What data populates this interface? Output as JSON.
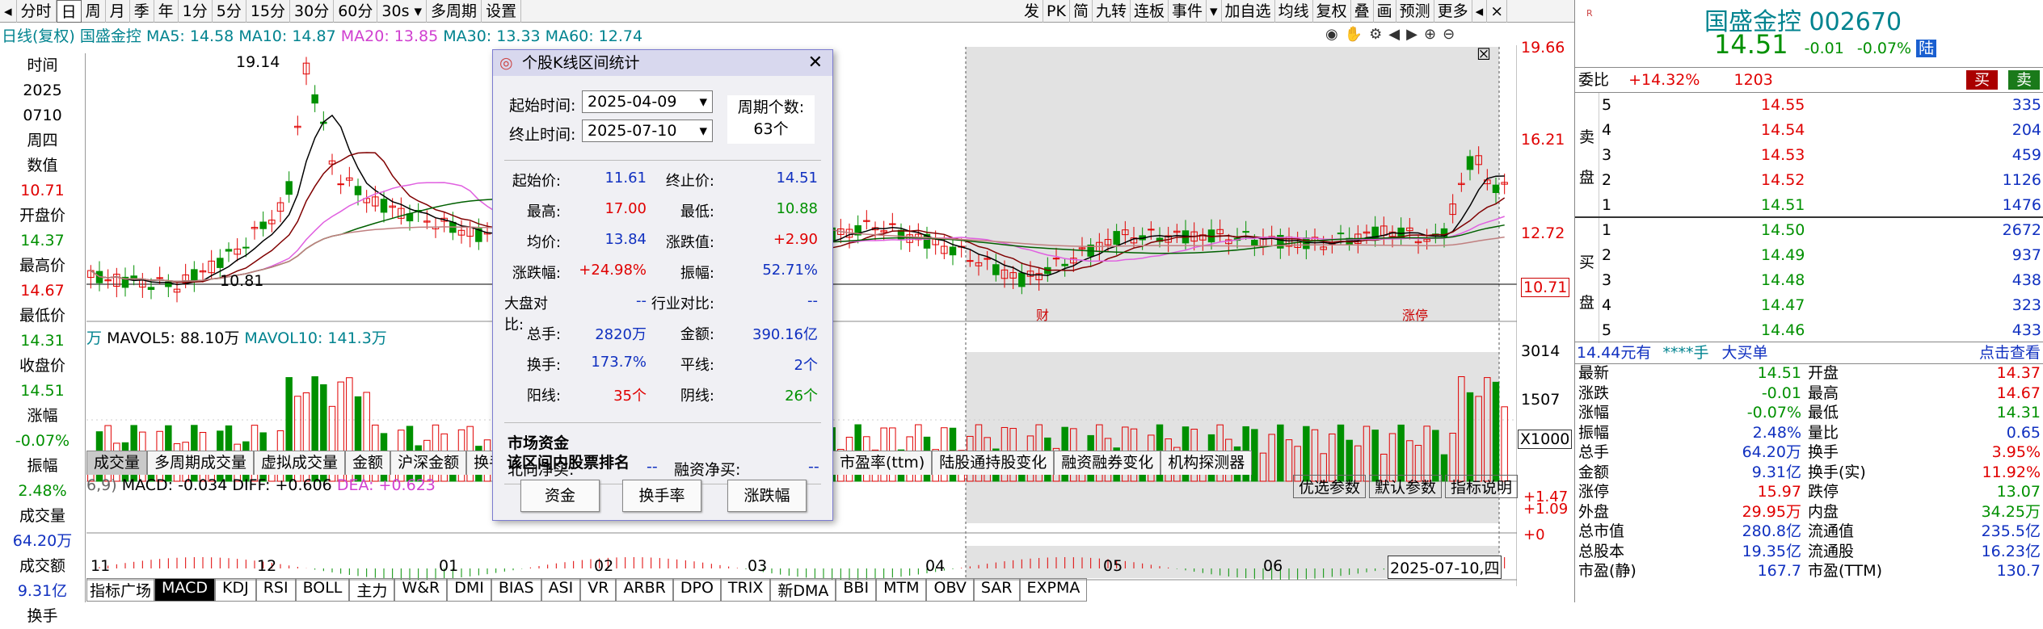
{
  "toolbar": {
    "items": [
      "分时",
      "日",
      "周",
      "月",
      "季",
      "年",
      "1分",
      "5分",
      "15分",
      "30分",
      "60分",
      "30s",
      "多周期",
      "设置"
    ],
    "right": [
      "发",
      "PK",
      "简",
      "九转",
      "连板",
      "事件",
      "加自选",
      "均线",
      "复权",
      "叠",
      "画",
      "预测",
      "更多"
    ]
  },
  "ma_line": {
    "label": "日线(复权)",
    "name": "国盛金控",
    "ma5": "MA5: 14.58",
    "ma10": "MA10: 14.87",
    "ma20": "MA20: 13.85",
    "ma30": "MA30: 13.33",
    "ma60": "MA60: 12.74"
  },
  "price_axis": [
    "19.66",
    "16.21",
    "12.72",
    "10.71"
  ],
  "chart_marks": {
    "high": "19.14",
    "low": "10.81"
  },
  "left_info": [
    [
      "时间",
      "2025",
      "0710",
      "周四"
    ],
    [
      "数值",
      "10.71"
    ],
    [
      "开盘价",
      "14.37"
    ],
    [
      "最高价",
      "14.67"
    ],
    [
      "最低价",
      "14.31"
    ],
    [
      "收盘价",
      "14.51"
    ],
    [
      "涨幅",
      "-0.07%"
    ],
    [
      "振幅",
      "2.48%"
    ],
    [
      "成交量",
      "64.20万"
    ],
    [
      "成交额",
      "9.31亿"
    ],
    [
      "换手"
    ]
  ],
  "vol_line": {
    "unit": "万",
    "mavol5": "MAVOL5: 88.10万",
    "mavol10": "MAVOL10: 141.3万"
  },
  "vol_axis": [
    "3014",
    "1507",
    "X1000"
  ],
  "indicator_tabs": [
    "成交量",
    "多周期成交量",
    "虚拟成交量",
    "金额",
    "沪深金额",
    "换手",
    "市盈率(ttm)",
    "陆股通持股变化",
    "融资融券变化",
    "机构探测器"
  ],
  "indicator_btns": [
    "优选参数",
    "默认参数",
    "指标说明"
  ],
  "macd_line": {
    "param": "6,9)",
    "macd": "MACD: -0.034",
    "diff": "DIFF: +0.606",
    "dea": "DEA: +0.623"
  },
  "macd_axis": [
    "+1.47",
    "+1.09",
    "+0"
  ],
  "x_axis": [
    "11",
    "12",
    "01",
    "02",
    "03",
    "04",
    "05",
    "06"
  ],
  "x_cursor": "2025-07-10,四",
  "bottom_tabs": [
    "指标广场",
    "MACD",
    "KDJ",
    "RSI",
    "BOLL",
    "主力",
    "W&R",
    "DMI",
    "BIAS",
    "ASI",
    "VR",
    "ARBR",
    "DPO",
    "TRIX",
    "新DMA",
    "BBI",
    "MTM",
    "OBV",
    "SAR",
    "EXPMA"
  ],
  "dialog": {
    "title": "个股K线区间统计",
    "start_label": "起始时间:",
    "start": "2025-04-09",
    "end_label": "终止时间:",
    "end": "2025-07-10",
    "period_label": "周期个数:",
    "period": "63个",
    "stats": [
      [
        "起始价:",
        "11.61",
        "终止价:",
        "14.51"
      ],
      [
        "最高:",
        "17.00",
        "最低:",
        "10.88"
      ],
      [
        "均价:",
        "13.84",
        "涨跌值:",
        "+2.90"
      ],
      [
        "涨跌幅:",
        "+24.98%",
        "振幅:",
        "52.71%"
      ],
      [
        "大盘对比:",
        "--",
        "行业对比:",
        "--"
      ],
      [
        "总手:",
        "2820万",
        "金额:",
        "390.16亿"
      ],
      [
        "换手:",
        "173.7%",
        "平线:",
        "2个"
      ],
      [
        "阳线:",
        "35个",
        "阴线:",
        "26个"
      ]
    ],
    "fund_title": "市场资金",
    "north_label": "北向净买:",
    "north": "--",
    "margin_label": "融资净买:",
    "margin": "--",
    "rank_title": "该区间内股票排名",
    "buttons": [
      "资金",
      "换手率",
      "涨跌幅"
    ]
  },
  "quote": {
    "name": "国盛金控 002670",
    "price": "14.51",
    "chg": "-0.01",
    "pct": "-0.07%",
    "tag": "陆",
    "weibi_label": "委比",
    "weibi": "+14.32%",
    "weicha": "1203",
    "buy": "买",
    "sell": "卖",
    "sells": [
      [
        "5",
        "14.55",
        "335"
      ],
      [
        "4",
        "14.54",
        "204"
      ],
      [
        "3",
        "14.53",
        "459"
      ],
      [
        "2",
        "14.52",
        "1126"
      ],
      [
        "1",
        "14.51",
        "1476"
      ]
    ],
    "buys": [
      [
        "1",
        "14.50",
        "2672"
      ],
      [
        "2",
        "14.49",
        "937"
      ],
      [
        "3",
        "14.48",
        "438"
      ],
      [
        "4",
        "14.47",
        "323"
      ],
      [
        "5",
        "14.46",
        "433"
      ]
    ],
    "sell_side": [
      "卖",
      "盘"
    ],
    "buy_side": [
      "买",
      "盘"
    ],
    "tick": {
      "left": "14.44元有",
      "mid": "****手",
      "big": "大买单",
      "link": "点击查看"
    },
    "stats": [
      [
        "最新",
        "14.51",
        "开盘",
        "14.37"
      ],
      [
        "涨跌",
        "-0.01",
        "最高",
        "14.67"
      ],
      [
        "涨幅",
        "-0.07%",
        "最低",
        "14.31"
      ],
      [
        "振幅",
        "2.48%",
        "量比",
        "0.65"
      ],
      [
        "总手",
        "64.20万",
        "换手",
        "3.95%"
      ],
      [
        "金额",
        "9.31亿",
        "换手(实)",
        "11.92%"
      ],
      [
        "涨停",
        "15.97",
        "跌停",
        "13.07"
      ],
      [
        "外盘",
        "29.95万",
        "内盘",
        "34.25万"
      ],
      [
        "总市值",
        "280.8亿",
        "流通值",
        "235.5亿"
      ],
      [
        "总股本",
        "19.35亿",
        "流通股",
        "16.23亿"
      ],
      [
        "市盈(静)",
        "167.7",
        "市盈(TTM)",
        "130.7"
      ]
    ]
  },
  "colors": {
    "up": "#e00000",
    "down": "#009000",
    "ma5": "#000000",
    "ma10": "#800000",
    "ma20": "#e060e0",
    "ma30": "#006000",
    "ma60": "#c08080"
  }
}
